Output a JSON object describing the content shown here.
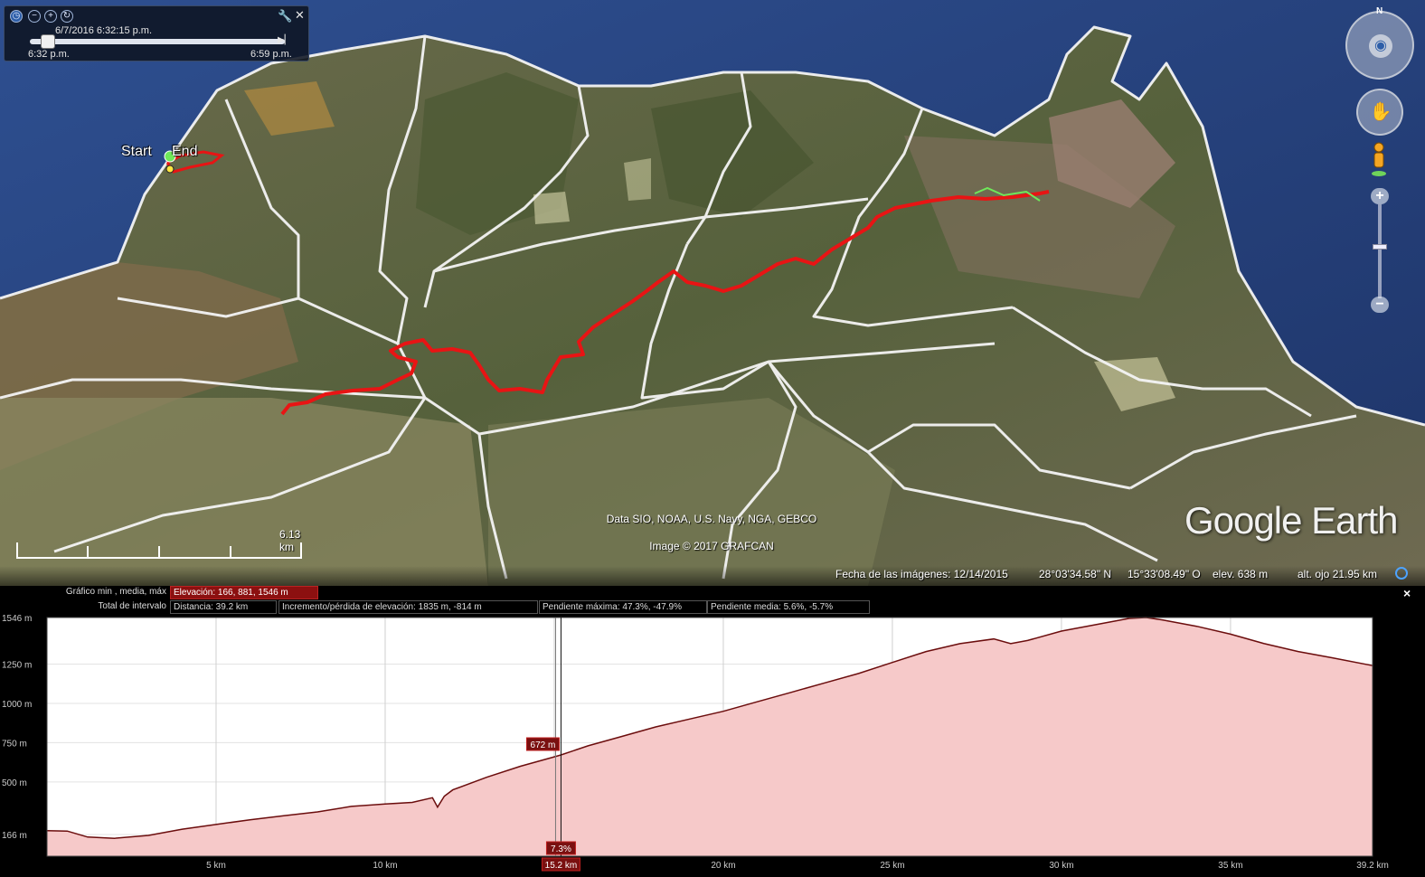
{
  "time_slider": {
    "current": "6/7/2016     6:32:15 p.m.",
    "start": "6:32 p.m.",
    "end": "6:59 p.m."
  },
  "map": {
    "start_label": "Start",
    "end_label": "End",
    "attribution": "Data SIO, NOAA, U.S. Navy, NGA, GEBCO",
    "copyright": "Image © 2017 GRAFCAN",
    "logo": "Google Earth",
    "scale": "6.13 km",
    "compass_letter": "N"
  },
  "status": {
    "imagery_date": "Fecha de las imágenes: 12/14/2015",
    "lat": "28°03'34.58\" N",
    "lon": "15°33'08.49\" O",
    "elev": "elev.   638 m",
    "eye_alt": "alt. ojo  21.95 km"
  },
  "profile": {
    "graph_label": "Gráfico  min , media, máx",
    "elevation_cell": "Elevación: 166, 881, 1546 m",
    "interval_label": "Total de intervalo",
    "distance_cell": "Distancia: 39.2 km",
    "gain_cell": "Incremento/pérdida de elevación: 1835 m, -814 m",
    "max_slope_cell": "Pendiente máxima: 47.3%, -47.9%",
    "avg_slope_cell": "Pendiente media: 5.6%, -5.7%",
    "cursor_elev": "672 m",
    "cursor_slope": "7.3%",
    "cursor_dist": "15.2 km",
    "close": "×"
  },
  "chart_data": {
    "type": "area",
    "title": "",
    "xlabel": "",
    "ylabel": "",
    "xlim": [
      0,
      39.2
    ],
    "ylim": [
      0,
      1546
    ],
    "y_ticks": [
      {
        "label": "1546 m",
        "value": 1546
      },
      {
        "label": "1250 m",
        "value": 1250
      },
      {
        "label": "1000 m",
        "value": 1000
      },
      {
        "label": "750 m",
        "value": 750
      },
      {
        "label": "500 m",
        "value": 500
      },
      {
        "label": "166 m",
        "value": 166
      }
    ],
    "x_ticks": [
      {
        "label": "5 km",
        "value": 5
      },
      {
        "label": "10 km",
        "value": 10
      },
      {
        "label": "15.2 km",
        "value": 15.2,
        "highlight": true
      },
      {
        "label": "20 km",
        "value": 20
      },
      {
        "label": "25 km",
        "value": 25
      },
      {
        "label": "30 km",
        "value": 30
      },
      {
        "label": "35 km",
        "value": 35
      },
      {
        "label": "39.2 km",
        "value": 39.2
      }
    ],
    "x_grid": [
      5,
      10,
      15,
      20,
      25,
      30,
      35
    ],
    "cursor": {
      "x": 15.2,
      "y": 672
    },
    "series": [
      {
        "x": [
          0,
          0.6,
          1.2,
          2.0,
          3.0,
          4.0,
          5.0,
          6.0,
          7.0,
          8.0,
          9.0,
          10.0,
          10.8,
          11.4,
          11.55,
          11.75,
          12.0,
          13.0,
          14.0,
          15.0,
          15.2,
          16.0,
          17.0,
          18.0,
          19.0,
          20.0,
          21.0,
          22.0,
          23.0,
          24.0,
          25.0,
          26.0,
          27.0,
          28.0,
          28.5,
          29.0,
          30.0,
          31.0,
          32.0,
          32.5,
          33.0,
          34.0,
          35.0,
          36.0,
          37.0,
          38.0,
          39.2
        ],
        "y": [
          190,
          188,
          150,
          142,
          160,
          200,
          230,
          260,
          285,
          310,
          345,
          360,
          370,
          400,
          340,
          410,
          450,
          530,
          600,
          660,
          672,
          730,
          790,
          850,
          900,
          950,
          1010,
          1070,
          1130,
          1190,
          1260,
          1330,
          1380,
          1410,
          1380,
          1400,
          1460,
          1500,
          1540,
          1546,
          1530,
          1490,
          1440,
          1380,
          1330,
          1290,
          1240
        ]
      }
    ]
  }
}
